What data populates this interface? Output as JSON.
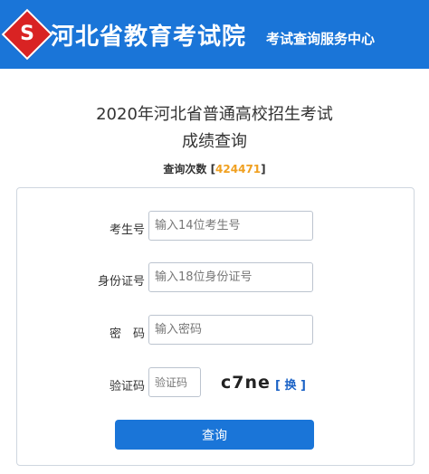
{
  "header": {
    "logo_glyph": "S",
    "site_name": "河北省教育考试院",
    "subtitle": "考试查询服务中心",
    "brand_color": "#1a75d8",
    "logo_color": "#d92323"
  },
  "page": {
    "title_line1": "2020年河北省普通高校招生考试",
    "title_line2": "成绩查询",
    "counter_label": "查询次数",
    "counter_open": "[",
    "counter_value": "424471",
    "counter_close": "]",
    "counter_color": "#f0a020"
  },
  "form": {
    "exam_number": {
      "label": "考生号",
      "placeholder": "输入14位考生号",
      "value": ""
    },
    "id_number": {
      "label": "身份证号",
      "placeholder": "输入18位身份证号",
      "value": ""
    },
    "password": {
      "label": "密　码",
      "placeholder": "输入密码",
      "value": ""
    },
    "captcha": {
      "label": "验证码",
      "placeholder": "验证码",
      "value": "",
      "image_text": "c7ne",
      "refresh_label": "[ 换 ]"
    },
    "submit_label": "查询"
  }
}
